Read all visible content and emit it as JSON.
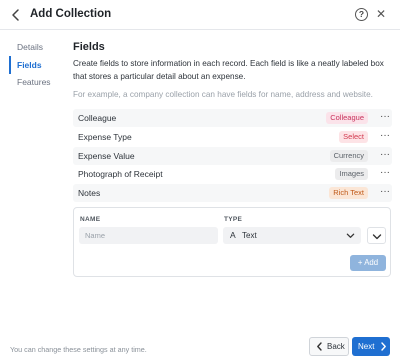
{
  "header": {
    "title": "Add Collection",
    "help_glyph": "?",
    "close_glyph": "✕"
  },
  "nav": {
    "items": [
      {
        "label": "Details",
        "active": false
      },
      {
        "label": "Fields",
        "active": true
      },
      {
        "label": "Features",
        "active": false
      }
    ]
  },
  "main": {
    "title": "Fields",
    "description": "Create fields to store information in each record. Each field is like a neatly labeled box that stores a particular detail about an expense.",
    "example": "For example, a company collection can have fields for name, address and website."
  },
  "fields": [
    {
      "name": "Colleague",
      "type": "Colleague",
      "badge_bg": "#fbe3ea",
      "badge_fg": "#c8325c"
    },
    {
      "name": "Expense Type",
      "type": "Select",
      "badge_bg": "#fde3e6",
      "badge_fg": "#d23a4f"
    },
    {
      "name": "Expense Value",
      "type": "Currency",
      "badge_bg": "#ececed",
      "badge_fg": "#5c6269"
    },
    {
      "name": "Photograph of Receipt",
      "type": "Images",
      "badge_bg": "#ececed",
      "badge_fg": "#5c6269"
    },
    {
      "name": "Notes",
      "type": "Rich Text",
      "badge_bg": "#fbe6d6",
      "badge_fg": "#c05a1a"
    }
  ],
  "more_glyph": "···",
  "new_field": {
    "name_label": "NAME",
    "type_label": "TYPE",
    "name_placeholder": "Name",
    "type_icon": "A",
    "type_value": "Text",
    "add_label": "+ Add"
  },
  "footer": {
    "note": "You can change these settings at any time.",
    "back_label": "Back",
    "next_label": "Next"
  },
  "colors": {
    "accent": "#1f6fd1",
    "add_disabled": "#8fb4dd"
  }
}
